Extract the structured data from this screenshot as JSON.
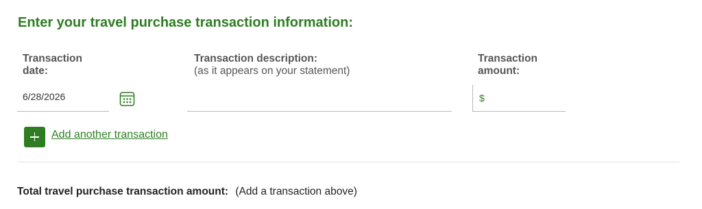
{
  "heading": "Enter your travel purchase transaction information:",
  "columns": {
    "date": {
      "label": "Transaction date:",
      "value": "6/28/2026"
    },
    "description": {
      "label": "Transaction description:",
      "sublabel": "(as it appears on your statement)",
      "value": ""
    },
    "amount": {
      "label": "Transaction amount:",
      "currency_symbol": "$",
      "value": ""
    }
  },
  "add_transaction": {
    "label": "Add another transaction",
    "icon": "plus-icon"
  },
  "total": {
    "label": "Total travel purchase transaction amount:",
    "value": "(Add a transaction above)"
  },
  "icons": {
    "calendar": "calendar-icon"
  },
  "colors": {
    "accent": "#2e7d22",
    "label": "#555555",
    "divider": "#e2e2e2"
  }
}
